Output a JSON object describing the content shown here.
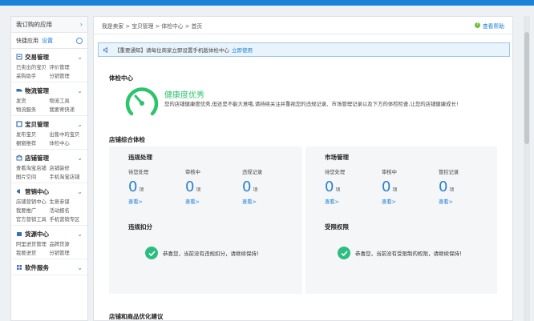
{
  "sidebar": {
    "header": "我订购的应用",
    "quick_label": "快捷应用",
    "quick_setting": "设置",
    "sections": [
      {
        "title": "交易管理",
        "links": [
          "已卖出的宝贝",
          "评价管理",
          "采购助手",
          "分销管理"
        ]
      },
      {
        "title": "物流管理",
        "links": [
          "发货",
          "物流工具",
          "物流服务",
          "我要寄快递"
        ]
      },
      {
        "title": "宝贝管理",
        "links": [
          "发布宝贝",
          "出售中的宝贝",
          "橱窗推荐",
          "体检中心"
        ]
      },
      {
        "title": "店铺管理",
        "links": [
          "查看淘宝店铺",
          "店铺装修",
          "图片空间",
          "手机淘宝店铺"
        ]
      },
      {
        "title": "营销中心",
        "links": [
          "店铺营销中心",
          "生意参谋",
          "我要推广",
          "活动报名",
          "官方营销工具",
          "手机营销专区"
        ]
      },
      {
        "title": "货源中心",
        "links": [
          "阿里进货管理",
          "品牌货源",
          "我要进货",
          "分销管理"
        ]
      },
      {
        "title": "软件服务",
        "links": []
      }
    ]
  },
  "breadcrumb": "我是卖家 > 宝贝管理 > 体检中心 > 首页",
  "help": "查看帮助",
  "notice": {
    "text": "【重要通知】请每位商家立即设置手机版体检中心",
    "link": "立即使用"
  },
  "check": {
    "title": "体检中心",
    "status": "健康度优秀",
    "desc": "您的店铺健康度优秀,但还是不能大意哦,请持续关注并重视您的违规记录、市场管理记录以及下方的体检检查,让您的店铺健康成长!"
  },
  "overall": {
    "title": "店铺综合体检",
    "violation": {
      "title": "违规处理",
      "stats": [
        {
          "label": "待您处理",
          "value": "0",
          "unit": "项",
          "link": "查看>"
        },
        {
          "label": "审核中",
          "value": "0",
          "unit": "项",
          "link": "查看>"
        },
        {
          "label": "违规记录",
          "value": "0",
          "unit": "项",
          "link": "查看>"
        }
      ]
    },
    "market": {
      "title": "市场管理",
      "stats": [
        {
          "label": "待您处理",
          "value": "0",
          "unit": "项",
          "link": "查看>"
        },
        {
          "label": "审核中",
          "value": "0",
          "unit": "项",
          "link": "查看>"
        },
        {
          "label": "管控记录",
          "value": "0",
          "unit": "项",
          "link": "查看>"
        }
      ]
    },
    "deduct": {
      "title": "违规扣分",
      "msg": "恭喜您，当前没有违规扣分，请继续保持！"
    },
    "limit": {
      "title": "受限权限",
      "msg": "恭喜您，当前没有受限制的权限，请继续保持！"
    }
  },
  "suggest_title": "店铺和商品优化建议",
  "colors": {
    "accent": "#1a82d9",
    "health": "#2dc46b",
    "check": "#2dbd7f",
    "link": "#1a7fd6"
  },
  "icons": {
    "help": "help-icon",
    "speaker": "speaker-icon",
    "gauge": "gauge-icon",
    "check": "check-icon",
    "gear": "gear-icon"
  }
}
